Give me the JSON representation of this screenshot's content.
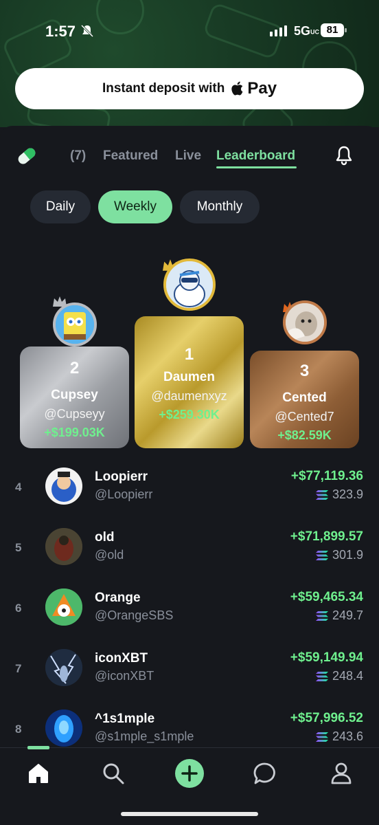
{
  "status_bar": {
    "time": "1:57",
    "network": "5G",
    "network_suffix": "UC",
    "battery": "81"
  },
  "deposit": {
    "label": "Instant deposit with",
    "pay_label": "Pay",
    "apple_glyph": ""
  },
  "tabs": {
    "count": "(7)",
    "featured": "Featured",
    "live": "Live",
    "leaderboard": "Leaderboard"
  },
  "periods": {
    "daily": "Daily",
    "weekly": "Weekly",
    "monthly": "Monthly"
  },
  "podium": [
    {
      "rank": "1",
      "name": "Daumen",
      "handle": "@daumenxyz",
      "pnl": "+$259.30K"
    },
    {
      "rank": "2",
      "name": "Cupsey",
      "handle": "@Cupseyy",
      "pnl": "+$199.03K"
    },
    {
      "rank": "3",
      "name": "Cented",
      "handle": "@Cented7",
      "pnl": "+$82.59K"
    }
  ],
  "leaderboard": [
    {
      "rank": "4",
      "name": "Loopierr",
      "handle": "@Loopierr",
      "pnl": "+$77,119.36",
      "sol": "323.9"
    },
    {
      "rank": "5",
      "name": "old",
      "handle": "@old",
      "pnl": "+$71,899.57",
      "sol": "301.9"
    },
    {
      "rank": "6",
      "name": "Orange",
      "handle": "@OrangeSBS",
      "pnl": "+$59,465.34",
      "sol": "249.7"
    },
    {
      "rank": "7",
      "name": "iconXBT",
      "handle": "@iconXBT",
      "pnl": "+$59,149.94",
      "sol": "248.4"
    },
    {
      "rank": "8",
      "name": "^1s1mple",
      "handle": "@s1mple_s1mple",
      "pnl": "+$57,996.52",
      "sol": "243.6"
    }
  ],
  "colors": {
    "accent": "#7ee0a0",
    "profit": "#6ff08e",
    "background": "#16181d",
    "gold": "#e2b93a",
    "silver": "#b9bcc1",
    "bronze": "#c07a48"
  },
  "icons": [
    "bell-off-icon",
    "pill-icon",
    "bell-icon",
    "crown-icon",
    "solana-icon",
    "home-icon",
    "search-icon",
    "plus-icon",
    "chat-icon",
    "profile-icon"
  ]
}
